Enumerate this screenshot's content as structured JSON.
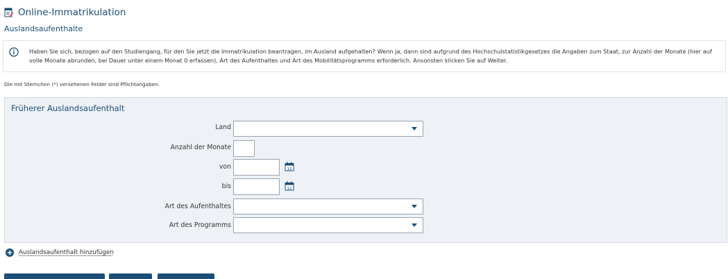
{
  "header": {
    "title": "Online-Immatrikulation",
    "subtitle": "Auslandsaufenthalte"
  },
  "info": {
    "text": "Haben Sie sich, bezogen auf den Studiengang, für den Sie jetzt die Immatrikulation beantragen, im Ausland aufgehalten? Wenn ja, dann sind aufgrund des Hochschulstatistikgesetzes die Angaben zum Staat, zur Anzahl der Monate (hier auf volle Monate abrunden, bei Dauer unter einem Monat 0 erfassen), Art des Aufenthaltes und Art des Mobilitätsprogramms erforderlich. Ansonsten klicken Sie auf Weiter."
  },
  "required_note": "Die mit Sternchen (*) versehenen Felder sind Pflichtangaben.",
  "panel": {
    "title": "Früherer Auslandsaufenthalt",
    "fields": {
      "land": {
        "label": "Land",
        "value": ""
      },
      "monate": {
        "label": "Anzahl der Monate",
        "value": ""
      },
      "von": {
        "label": "von",
        "value": ""
      },
      "bis": {
        "label": "bis",
        "value": ""
      },
      "art_aufenthalt": {
        "label": "Art des Aufenthaltes",
        "value": ""
      },
      "art_programm": {
        "label": "Art des Programms",
        "value": ""
      }
    }
  },
  "add_link": "Auslandsaufenthalt hinzufügen",
  "icons": {
    "title": "edit-document-icon",
    "info": "info-circle-icon",
    "calendar": "calendar-icon",
    "add": "plus-circle-icon",
    "dropdown": "chevron-down-icon"
  },
  "colors": {
    "accent": "#1b4f7a",
    "panel_bg": "#eef1f5",
    "border": "#9aa4ae"
  }
}
